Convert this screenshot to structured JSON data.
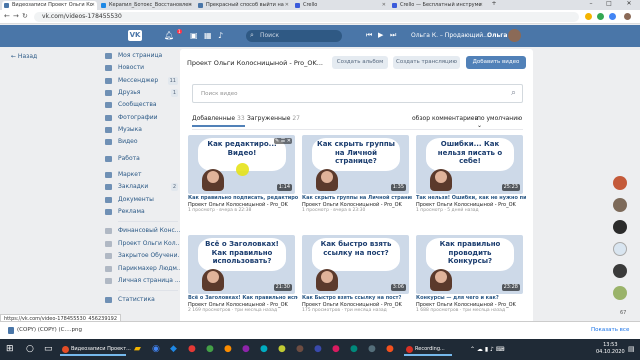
{
  "browser": {
    "tabs": [
      {
        "title": "Видеозаписи Проект Ольги Ко",
        "active": true
      },
      {
        "title": "Керапил_Ботокс_Восстановлен"
      },
      {
        "title": "Прекрасный способ выйти на"
      },
      {
        "title": "Crello"
      },
      {
        "title": "Crello — Бесплатный инструме"
      }
    ],
    "url": "vk.com/videos-178455530",
    "window_controls": [
      "–",
      "□",
      "✕"
    ]
  },
  "vk_header": {
    "logo": "VK",
    "notifications_count": "1",
    "search_placeholder": "Поиск",
    "user_status": "Ольга К. – Продающий...",
    "user_name": "Ольга"
  },
  "sidebar": {
    "back_label": "← Назад",
    "items": [
      {
        "label": "Моя страница",
        "icon": "home-icon"
      },
      {
        "label": "Новости",
        "icon": "news-icon"
      },
      {
        "label": "Мессенджер",
        "icon": "message-icon",
        "count": "11"
      },
      {
        "label": "Друзья",
        "icon": "friends-icon",
        "count": "1"
      },
      {
        "label": "Сообщества",
        "icon": "groups-icon"
      },
      {
        "label": "Фотографии",
        "icon": "photo-icon"
      },
      {
        "label": "Музыка",
        "icon": "music-icon"
      },
      {
        "label": "Видео",
        "icon": "video-icon"
      },
      {
        "label": "Работа",
        "icon": "work-icon"
      },
      {
        "label": "Маркет",
        "icon": "market-icon"
      },
      {
        "label": "Закладки",
        "icon": "bookmark-icon",
        "count": "2"
      },
      {
        "label": "Документы",
        "icon": "document-icon"
      },
      {
        "label": "Реклама",
        "icon": "ads-icon"
      },
      {
        "label": "Финансовый Конс...",
        "icon": "community-icon"
      },
      {
        "label": "Проект Ольги Кол...",
        "icon": "community-icon"
      },
      {
        "label": "Закрытое Обучени...",
        "icon": "community-icon"
      },
      {
        "label": "Парикмахер Людм...",
        "icon": "community-icon"
      },
      {
        "label": "Личная страница ...",
        "icon": "community-icon"
      },
      {
        "label": "Статистика",
        "icon": "stats-icon"
      }
    ]
  },
  "main": {
    "title": "Проект Ольги Колосницыной - Pro_OK...",
    "buttons": {
      "create_album": "Создать альбом",
      "create_stream": "Создать трансляцию",
      "add_video": "Добавить видео"
    },
    "search_placeholder": "Поиск видео",
    "tabs": [
      {
        "label": "Добавленные",
        "count": "33",
        "active": true
      },
      {
        "label": "Загруженные",
        "count": "27"
      }
    ],
    "sort": {
      "comments_label": "обзор комментариев",
      "order_label": "по умолчанию"
    },
    "videos": [
      {
        "thumb_text": "Как редактиро... Видео!",
        "duration": "1:14",
        "title": "Как правильно подписать, редактиров...",
        "author": "Проект Ольги Колосницыной - Pro_OK",
        "meta": "1 просмотр · вчера в 22:38"
      },
      {
        "thumb_text": "Как скрыть группы на Личной странице?",
        "duration": "1:35",
        "title": "Как скрыть группы на Личной странице?",
        "author": "Проект Ольги Колосницыной - Pro_OK",
        "meta": "1 просмотр · вчера в 23:30"
      },
      {
        "thumb_text": "Ошибки... Как нельзя писать о себе!",
        "duration": "25:23",
        "title": "Так нельзя! Ошибки, как не нужно писа...",
        "author": "Проект Ольги Колосницыной - Pro_OK",
        "meta": "1 просмотр · 5 дней назад"
      },
      {
        "thumb_text": "Всё о Заголовках! Как правильно использовать?",
        "duration": "21:30",
        "title": "Всё о Заголовках! Как правильно испол...",
        "author": "Проект Ольги Колосницыной - Pro_OK",
        "meta": "2 169 просмотров · три месяца назад"
      },
      {
        "thumb_text": "Как быстро взять ссылку на пост?",
        "duration": "3:06",
        "title": "Как Быстро взять ссылку на пост?",
        "author": "Проект Ольги Колосницыной - Pro_OK",
        "meta": "175 просмотров · три месяца назад"
      },
      {
        "thumb_text": "Как правильно проводить Конкурсы?",
        "duration": "23:28",
        "title": "Конкурсы — для чего и как?",
        "author": "Проект Ольги Колосницыной - Pro_OK",
        "meta": "1 688 просмотров · три месяца назад"
      }
    ]
  },
  "right_panel": {
    "count": "67"
  },
  "status_url": "https://vk.com/video-178455530_456239192",
  "downloads": {
    "item": "(COPY) (COPY) (C....png",
    "show_all": "Показать все"
  },
  "taskbar": {
    "apps": [
      {
        "label": "Видеозаписи Проект...",
        "color": "#e44d26"
      },
      {
        "label": "Recording...",
        "color": "#d93025"
      }
    ],
    "time": "13:53",
    "date": "04.10.2020"
  },
  "colors": {
    "vk_blue": "#4a76a8",
    "link": "#2a5885",
    "button_blue": "#5181b8"
  }
}
